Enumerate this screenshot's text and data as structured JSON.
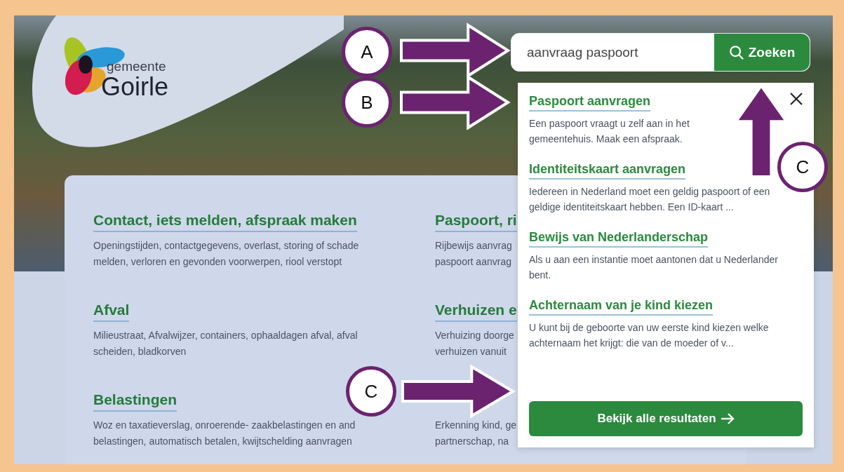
{
  "header": {
    "logo": {
      "line_1": "gemeente",
      "line_2": "Goirle"
    }
  },
  "search": {
    "value": "aanvraag paspoort",
    "button": "Zoeken"
  },
  "categories_left": [
    {
      "heading": "Contact, iets melden, afspraak maken",
      "lines": [
        "Openingstijden, contactgegevens, overlast, storing of schade",
        "melden, verloren en gevonden voorwerpen, riool verstopt"
      ]
    },
    {
      "heading": "Afval",
      "lines": [
        "Milieustraat, Afvalwijzer, containers, ophaaldagen afval, afval",
        "scheiden, bladkorven"
      ]
    },
    {
      "heading": "Belastingen",
      "lines": [
        "Woz en taxatieverslag, onroerende- zaakbelastingen en and",
        "belastingen, automatisch betalen, kwijtschelding aanvragen"
      ]
    }
  ],
  "categories_right": [
    {
      "heading": "Paspoort, ri",
      "lines": [
        "Rijbewijs aanvrag",
        "paspoort aanvrag"
      ]
    },
    {
      "heading": "Verhuizen e",
      "lines": [
        "Verhuizing doorge",
        "verhuizen vanuit"
      ]
    },
    {
      "lines": [
        "Erkenning kind, ge",
        "partnerschap, na"
      ]
    }
  ],
  "suggestions": {
    "results": [
      {
        "title": "Paspoort aanvragen",
        "description": "Een paspoort vraagt u zelf aan in het gemeentehuis. Maak een afspraak."
      },
      {
        "title": "Identiteitskaart aanvragen",
        "description": "Iedereen in Nederland moet een geldig paspoort of een geldige identiteitskaart hebben. Een ID-kaart ..."
      },
      {
        "title": "Bewijs van Nederlanderschap",
        "description": "Als u aan een instantie moet aantonen dat u Nederlander bent."
      },
      {
        "title": "Achternaam van je kind kiezen",
        "description": "U kunt bij de geboorte van uw eerste kind kiezen welke achternaam het krijgt: die van de moeder of v..."
      }
    ],
    "button": "Bekijk alle resultaten"
  },
  "annotations": [
    {
      "label": "A",
      "kind": "right"
    },
    {
      "label": "B",
      "kind": "right"
    },
    {
      "label": "C",
      "kind": "up"
    },
    {
      "label": "C",
      "kind": "right"
    }
  ]
}
